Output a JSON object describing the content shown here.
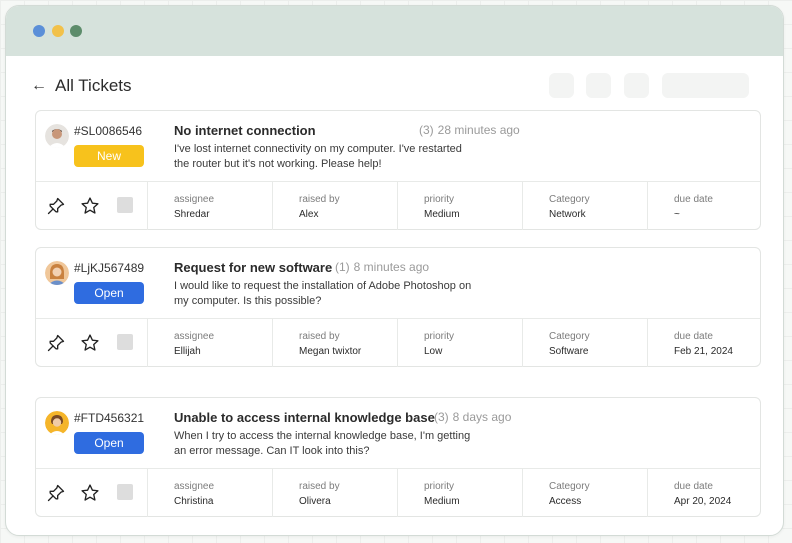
{
  "header": {
    "back_icon": "back-arrow-icon",
    "title": "All Tickets"
  },
  "field_labels": {
    "assignee": "assignee",
    "raised_by": "raised by",
    "priority": "priority",
    "category": "Category",
    "due_date": "due date"
  },
  "tickets": [
    {
      "id": "#SL0086546",
      "status": "New",
      "title": "No internet connection",
      "count": "(3)",
      "time": "28 minutes ago",
      "description": "I've lost internet connectivity on my computer. I've restarted the router but it's not working. Please help!",
      "assignee": "Shredar",
      "raised_by": "Alex",
      "priority": "Medium",
      "category": "Network",
      "due_date": "~"
    },
    {
      "id": "#LjKJ567489",
      "status": "Open",
      "title": "Request for new software",
      "count": "(1)",
      "time": "8 minutes ago",
      "description": "I would like to request the installation of Adobe Photoshop on my computer. Is this possible?",
      "assignee": "Ellijah",
      "raised_by": "Megan twixtor",
      "priority": "Low",
      "category": "Software",
      "due_date": "Feb 21, 2024"
    },
    {
      "id": "#FTD456321",
      "status": "Open",
      "title": "Unable to access internal knowledge base",
      "count": "(3)",
      "time": "8 days ago",
      "description": "When I try to access the internal knowledge base, I'm getting an error message. Can IT look into this?",
      "assignee": "Christina",
      "raised_by": "Olivera",
      "priority": "Medium",
      "category": "Access",
      "due_date": "Apr 20, 2024"
    }
  ],
  "colors": {
    "status_new": "#f7c21c",
    "status_open": "#2f6ce0",
    "titlebar": "#d6e2dc"
  }
}
